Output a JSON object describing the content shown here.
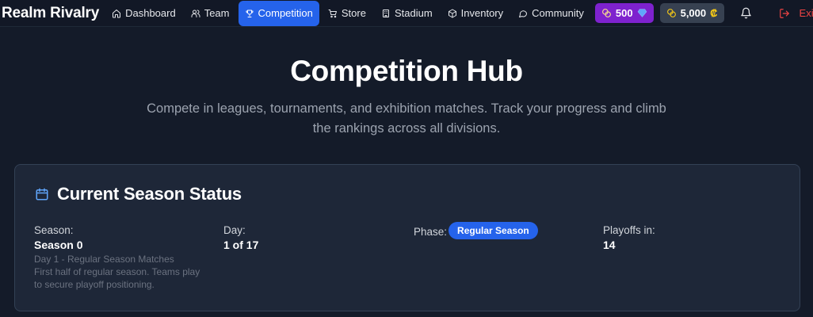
{
  "brand": "Realm Rivalry",
  "nav": {
    "items": [
      {
        "label": "Dashboard",
        "icon": "home-icon"
      },
      {
        "label": "Team",
        "icon": "users-icon"
      },
      {
        "label": "Competition",
        "icon": "trophy-icon",
        "active": true
      },
      {
        "label": "Store",
        "icon": "cart-icon"
      },
      {
        "label": "Stadium",
        "icon": "building-icon"
      },
      {
        "label": "Inventory",
        "icon": "box-icon"
      },
      {
        "label": "Community",
        "icon": "chat-icon"
      }
    ]
  },
  "currency": {
    "gems": "500",
    "coins": "5,000",
    "gems_color": "#7e22ce",
    "coins_color": "#374151"
  },
  "exit_label": "Exit",
  "hero": {
    "title": "Competition Hub",
    "subtitle": "Compete in leagues, tournaments, and exhibition matches. Track your progress and climb the rankings across all divisions."
  },
  "season_card": {
    "title": "Current Season Status",
    "season_label": "Season:",
    "season_value": "Season 0",
    "season_detail": "Day 1 - Regular Season Matches",
    "season_description": "First half of regular season. Teams play to secure playoff positioning.",
    "day_label": "Day:",
    "day_value": "1 of 17",
    "phase_label": "Phase:",
    "phase_value": "Regular Season",
    "playoffs_label": "Playoffs in:",
    "playoffs_value": "14"
  },
  "colors": {
    "accent": "#2563eb",
    "background": "#141b29",
    "card": "#1e2738",
    "danger": "#ef4444"
  }
}
